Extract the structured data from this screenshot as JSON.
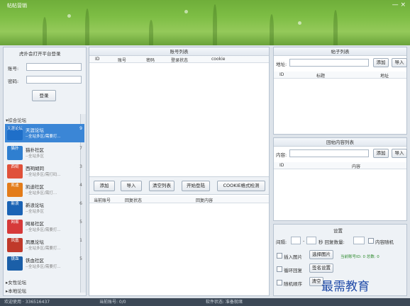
{
  "app": {
    "title": "帖帖营销",
    "window_controls": "— ×"
  },
  "login": {
    "heading": "虎扑会打开平台登录",
    "account_label": "账号:",
    "password_label": "密码:",
    "login_button": "登录"
  },
  "sites": {
    "group_label": "▾综合论坛",
    "items": [
      {
        "logo": "天涯论坛",
        "name": "天涯论坛",
        "desc": "--全站多区/需要打...",
        "count": "9",
        "color": "#1f6fc9",
        "selected": true
      },
      {
        "logo": "猫扑",
        "name": "猫扑社区",
        "desc": "--全站多区",
        "count": "7",
        "color": "#2f7fd0",
        "selected": false
      },
      {
        "logo": "西祠",
        "name": "西祠胡同",
        "desc": "--全站多区/需打码...",
        "count": "3",
        "color": "#e0513a",
        "selected": false
      },
      {
        "logo": "凯迪",
        "name": "凯迪社区",
        "desc": "--全站多区/需打...",
        "count": "4",
        "color": "#e37c1a",
        "selected": false
      },
      {
        "logo": "新浪",
        "name": "新浪论坛",
        "desc": "--全站多区",
        "count": "6",
        "color": "#1a63b5",
        "selected": false
      },
      {
        "logo": "网易",
        "name": "网易社区",
        "desc": "--全站多区/需要打...",
        "count": "5",
        "color": "#d63a3a",
        "selected": false
      },
      {
        "logo": "凤凰",
        "name": "凤凰论坛",
        "desc": "--全站多区/需要打...",
        "count": "1",
        "color": "#c0392b",
        "selected": false
      },
      {
        "logo": "铁血",
        "name": "铁血社区",
        "desc": "--全站多区/需要打...",
        "count": "5",
        "color": "#1b5fa8",
        "selected": false
      }
    ],
    "footer_groups": [
      "▸女性论坛",
      "▸本地论坛"
    ]
  },
  "accounts": {
    "heading": "账号列表",
    "columns": [
      "ID",
      "账号",
      "密码",
      "登录状态",
      "cookie"
    ],
    "buttons": [
      "添加",
      "导入",
      "清空列表",
      "开始登陆",
      "COOKIE格式检测"
    ],
    "lower_columns": [
      "当前账号",
      "回复状态",
      "回复内容"
    ]
  },
  "posts": {
    "heading": "帖子列表",
    "url_label": "地址:",
    "add": "添加",
    "import": "导入",
    "columns": [
      "ID",
      "标题",
      "地址"
    ]
  },
  "replies": {
    "heading": "回帖内容列表",
    "content_label": "内容:",
    "add": "添加",
    "import": "导入",
    "columns": [
      "ID",
      "内容"
    ]
  },
  "settings": {
    "heading": "设置",
    "interval_label": "间隔:",
    "dash": "-",
    "seconds_label": "秒 回复数量:",
    "content_random": "内容随机",
    "insert_image": "插入图片",
    "select_image": "选择图片",
    "stats": "当前账号ID: 0 总数: 0",
    "loop_reply": "循环回复",
    "sig_settings": "签名设置",
    "random_order": "随机顺序",
    "clear": "清空"
  },
  "status": {
    "left": "欢迎使用 · 336516437",
    "mid": "当前账号: 0/0",
    "right": "软件状态: 准备就绪"
  },
  "watermark": "最需教育"
}
